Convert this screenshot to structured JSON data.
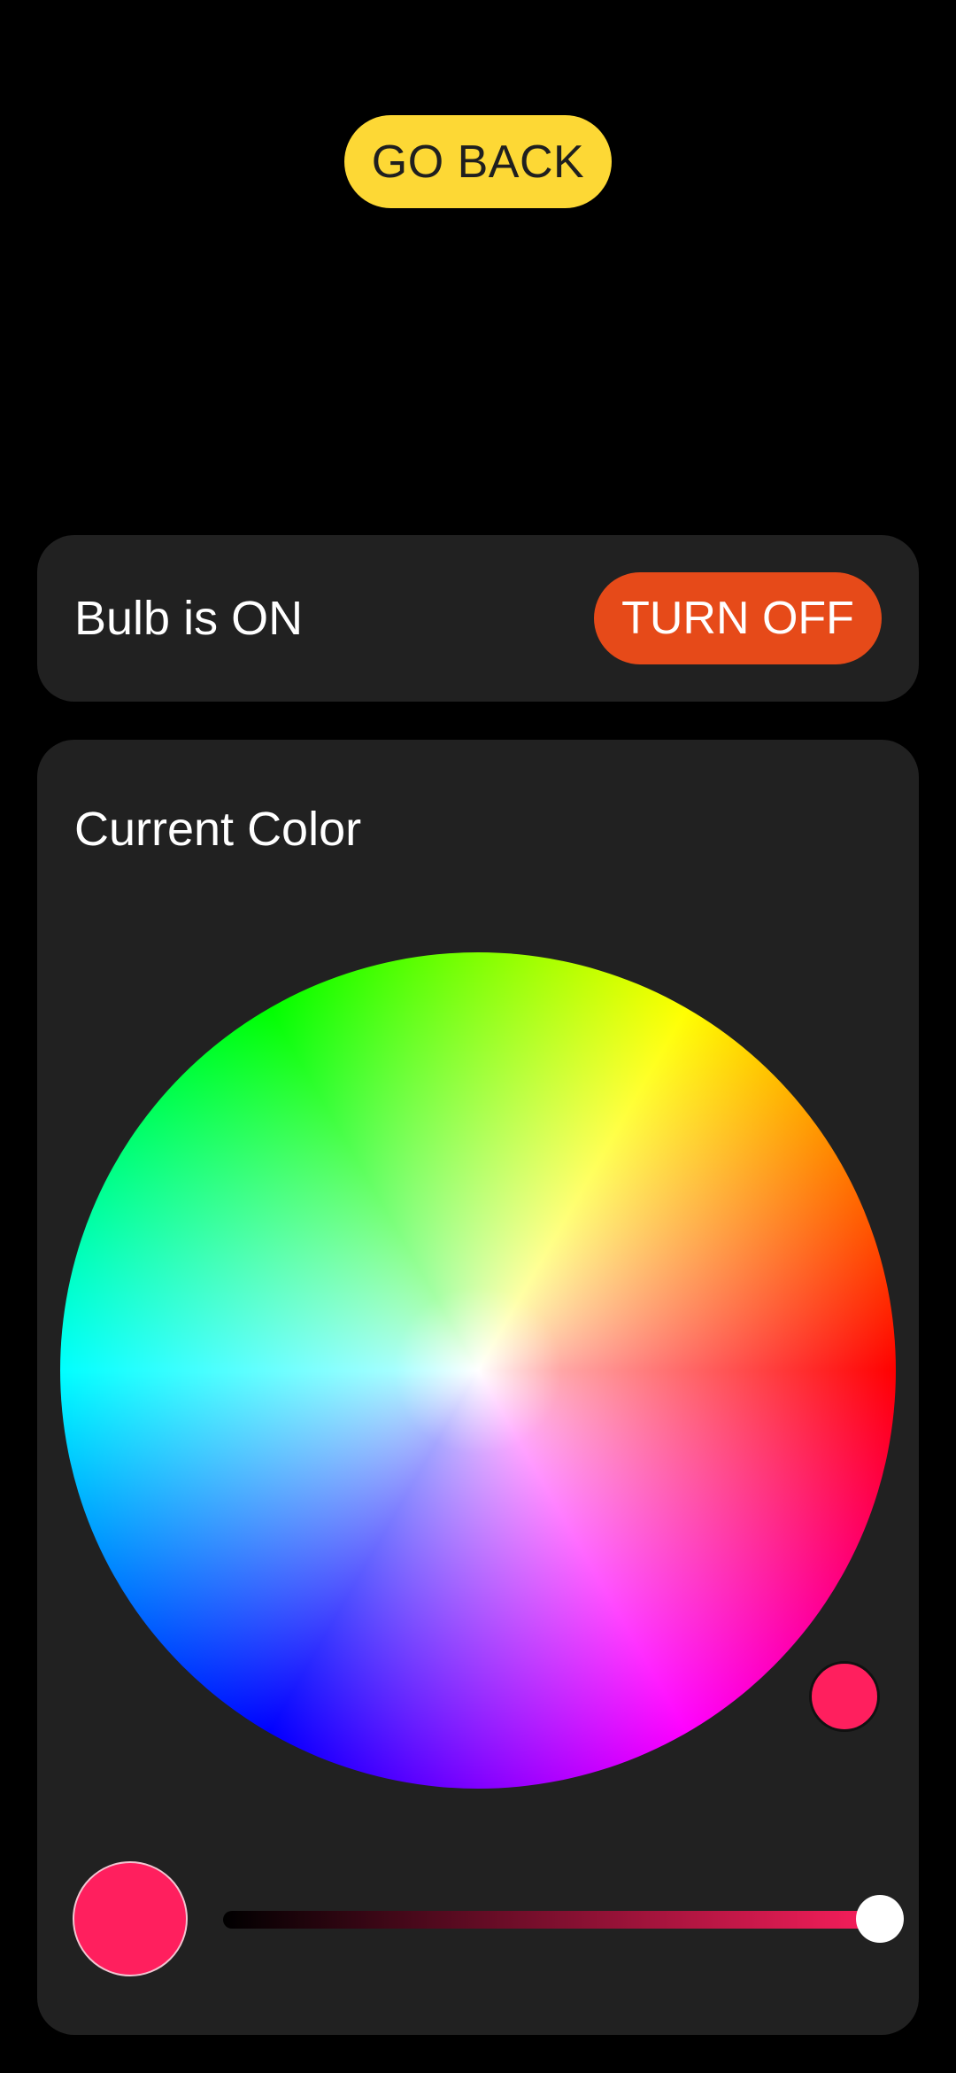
{
  "nav": {
    "go_back_label": "GO BACK"
  },
  "bulb": {
    "status_text": "Bulb is ON",
    "toggle_label": "TURN OFF"
  },
  "color": {
    "title": "Current Color",
    "selected_hex": "#ff1f5e",
    "brightness_percent": 100
  },
  "theme": {
    "background": "#000000",
    "card": "#212121",
    "go_back_button": "#fdd835",
    "turn_off_button": "#e64a19"
  }
}
